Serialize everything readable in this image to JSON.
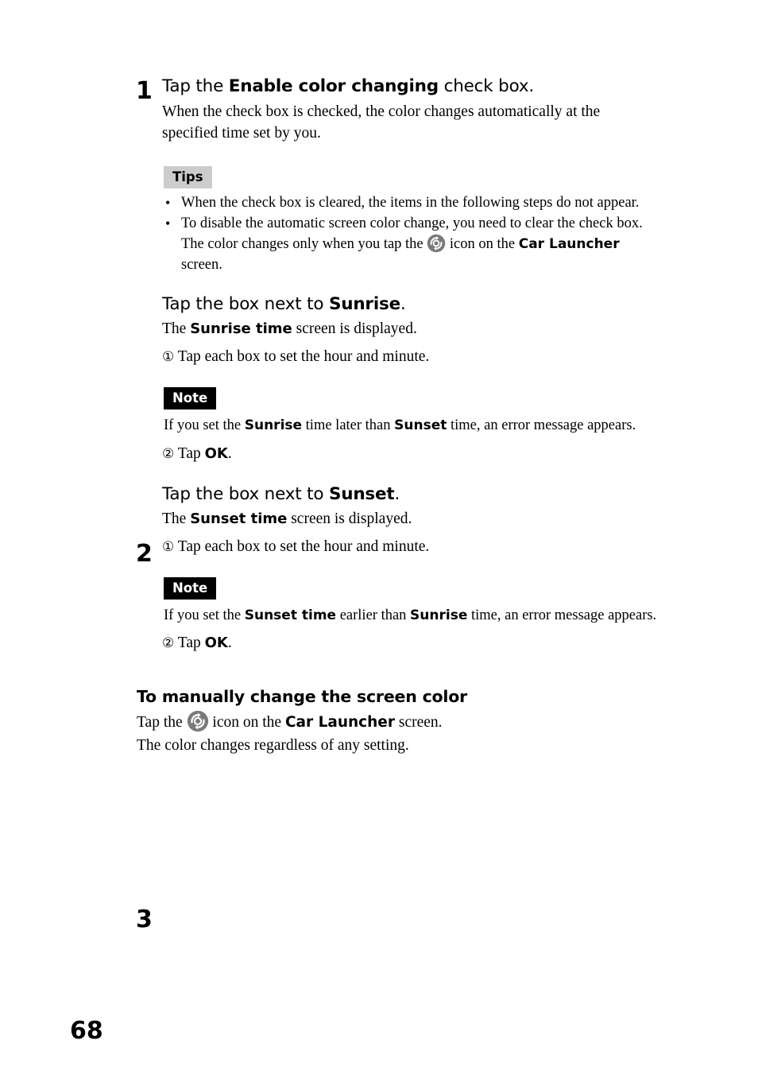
{
  "page": {
    "number": "68"
  },
  "steps": [
    {
      "num": "1",
      "title_pre": "Tap the ",
      "title_bold": "Enable color changing",
      "title_post": " check box.",
      "body": "When the check box is checked, the color changes automatically at the specified time set by you."
    },
    {
      "num": "2",
      "title_pre": "Tap the box next to ",
      "title_bold": "Sunrise",
      "title_post": ".",
      "body_pre": "The ",
      "body_bold": "Sunrise time",
      "body_post": " screen is displayed.",
      "substep1_num": "①",
      "substep1_text": " Tap each box to set the hour and minute.",
      "substep2_num": "②",
      "substep2_pre": " Tap ",
      "substep2_bold": "OK",
      "substep2_post": "."
    },
    {
      "num": "3",
      "title_pre": "Tap the box next to ",
      "title_bold": "Sunset",
      "title_post": ".",
      "body_pre": "The ",
      "body_bold": "Sunset time",
      "body_post": " screen is displayed.",
      "substep1_num": "①",
      "substep1_text": " Tap each box to set the hour and minute.",
      "substep2_num": "②",
      "substep2_pre": " Tap ",
      "substep2_bold": "OK",
      "substep2_post": "."
    }
  ],
  "tips": {
    "badge_label": "Tips",
    "bullet_marker": "•",
    "item1": "When the check box is cleared, the items in the following steps do not appear.",
    "item2_line1": "To disable the automatic screen color change, you need to clear the check box.",
    "item2_line2_pre": "The color changes only when you tap the ",
    "item2_line2_mid": " icon on the ",
    "item2_line2_bold": "Car Launcher",
    "item2_line2_post": " screen.",
    "rotate_icon_name": "rotate-color-icon"
  },
  "note_sunrise": {
    "badge_label": "Note",
    "text_pre": "If you set the ",
    "text_bold1": "Sunrise",
    "text_mid": " time later than ",
    "text_bold2": "Sunset",
    "text_post": " time, an error message appears."
  },
  "note_sunset": {
    "badge_label": "Note",
    "text_pre": "If you set the ",
    "text_bold1": "Sunset time",
    "text_mid": " earlier than ",
    "text_bold2": "Sunrise",
    "text_post": " time, an error message appears."
  },
  "manual_section": {
    "heading": "To manually change the screen color",
    "line1_pre": "Tap the ",
    "line1_mid": " icon on the ",
    "line1_bold": "Car Launcher",
    "line1_post": " screen.",
    "line2": "The color changes regardless of any setting.",
    "rotate_icon_name": "rotate-color-icon"
  },
  "colors": {
    "tips_badge_bg": "#cccccc",
    "note_badge_bg": "#000000",
    "icon_gray": "#7a7a7a",
    "text": "#000000"
  }
}
